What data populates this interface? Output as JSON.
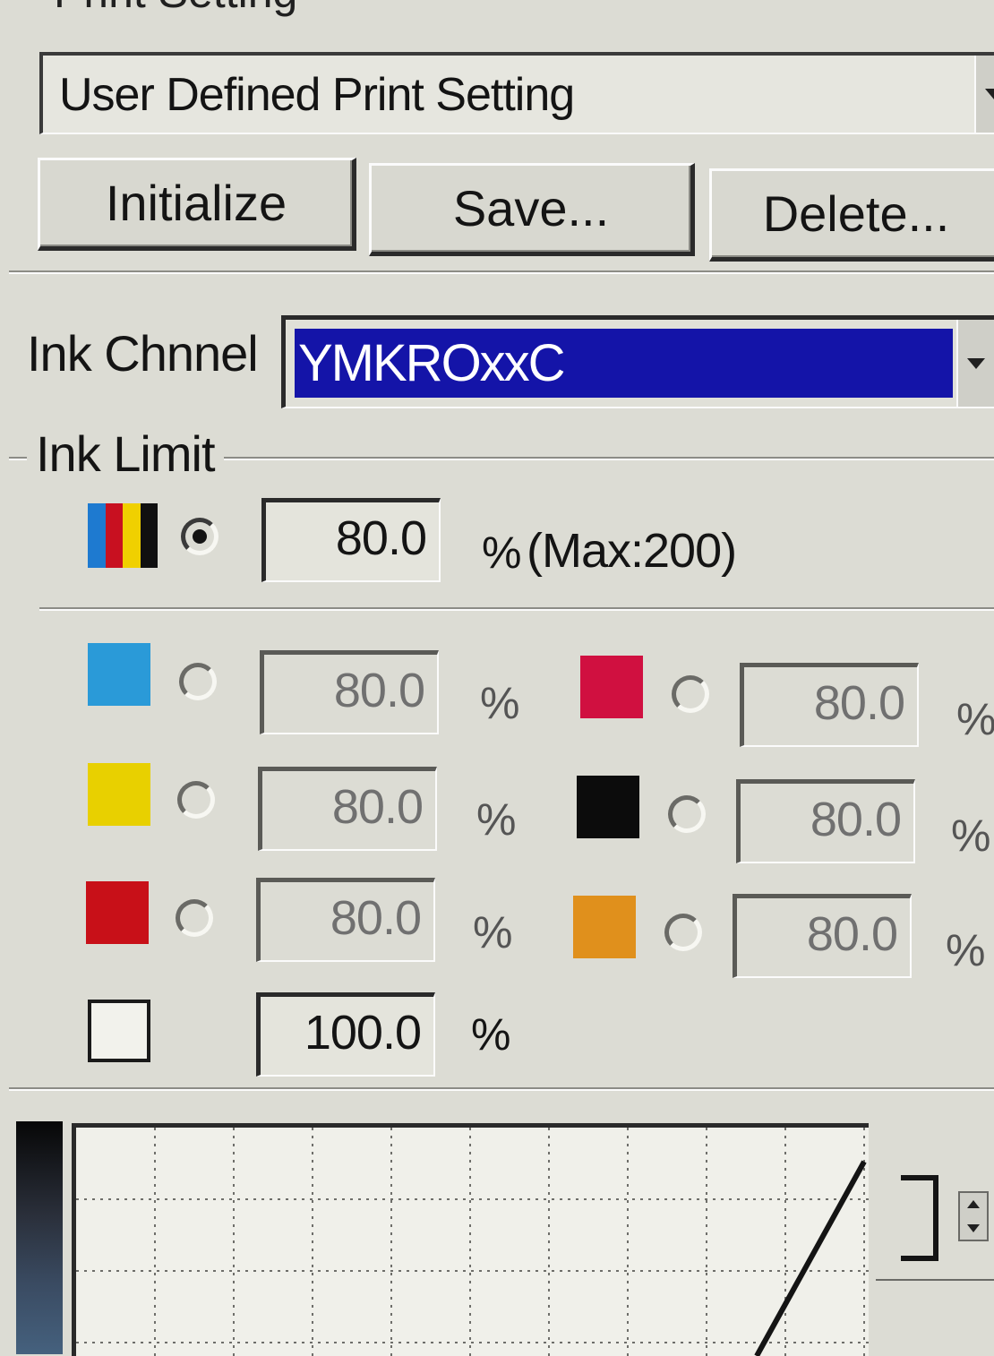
{
  "section_title": "Print Setting",
  "preset": {
    "value": "User Defined Print Setting"
  },
  "buttons": {
    "initialize": "Initialize",
    "save": "Save...",
    "delete": "Delete..."
  },
  "ink_channel": {
    "label": "Ink Chnnel",
    "value": "YMKROxxC",
    "selection_color": "#1414a8"
  },
  "ink_limit": {
    "title": "Ink Limit",
    "total": {
      "value": "80.0",
      "unit": "%",
      "max_note": "(Max:200)",
      "selected": true,
      "icon_colors": [
        "#1e7ad0",
        "#c81020",
        "#f0d000",
        "#101010"
      ]
    },
    "channels": [
      {
        "name": "cyan",
        "color": "#2a9ad8",
        "value": "80.0",
        "unit": "%",
        "selected": false
      },
      {
        "name": "magenta",
        "color": "#d01040",
        "value": "80.0",
        "unit": "%",
        "selected": false
      },
      {
        "name": "yellow",
        "color": "#e8d000",
        "value": "80.0",
        "unit": "%",
        "selected": false
      },
      {
        "name": "black",
        "color": "#0c0c0c",
        "value": "80.0",
        "unit": "%",
        "selected": false
      },
      {
        "name": "red",
        "color": "#c81018",
        "value": "80.0",
        "unit": "%",
        "selected": false
      },
      {
        "name": "orange",
        "color": "#e0901c",
        "value": "80.0",
        "unit": "%",
        "selected": false
      }
    ],
    "white": {
      "color": "#f2f2ec",
      "value": "100.0",
      "unit": "%"
    }
  },
  "curve": {
    "grid": true,
    "gradient_colors": [
      "#070707",
      "#45617e"
    ],
    "line_color": "#141414"
  }
}
